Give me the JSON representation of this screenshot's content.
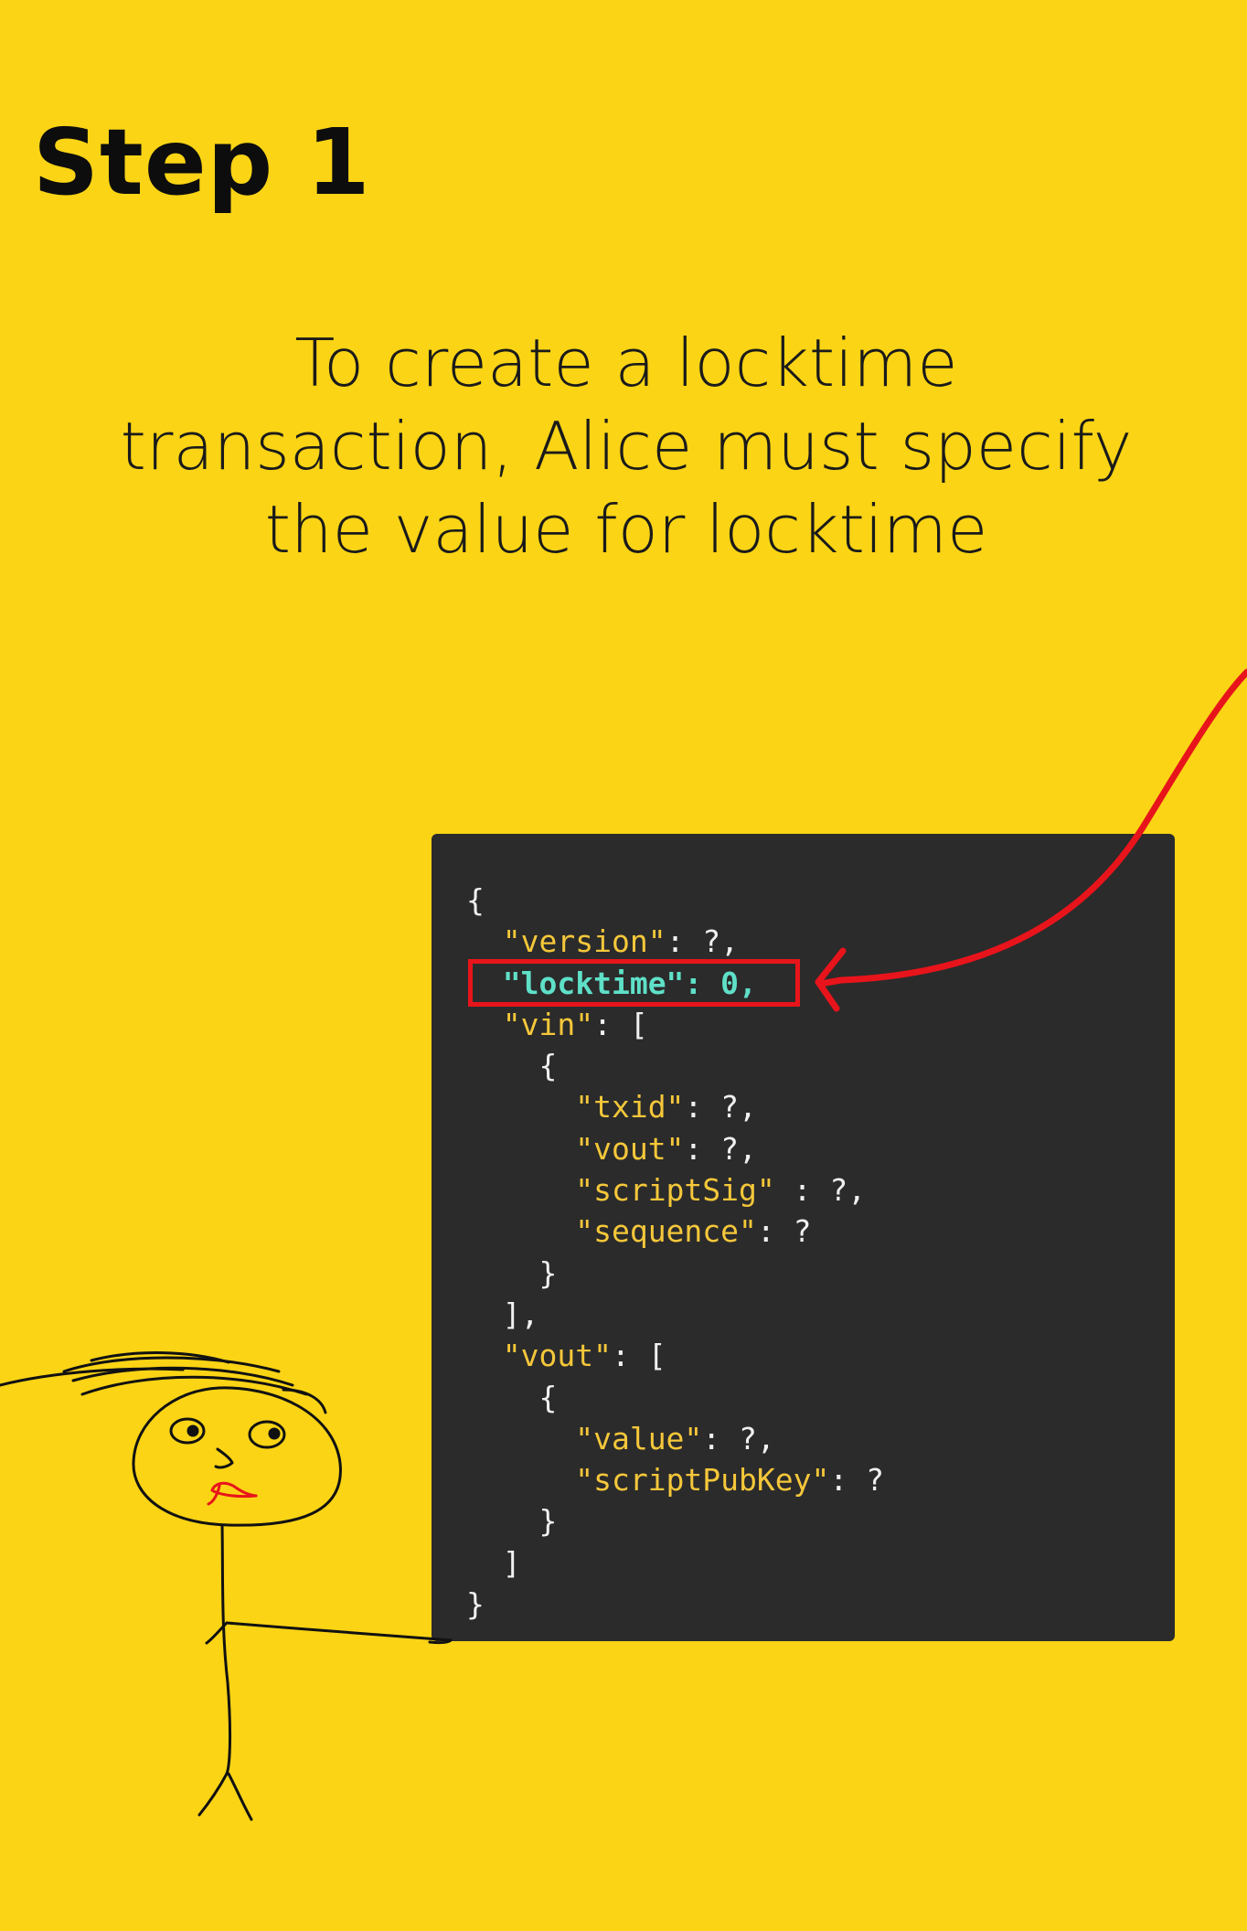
{
  "heading": "Step 1",
  "caption": {
    "line1": "To create a locktime",
    "line2": "transaction, Alice must specify",
    "line3": "the value for locktime"
  },
  "code": {
    "lines": [
      "{",
      "  \"version\": ?,",
      "  \"locktime\": 0,",
      "  \"vin\": [",
      "    {",
      "      \"txid\": ?,",
      "      \"vout\": ?,",
      "      \"scriptSig\" : ?,",
      "      \"sequence\": ?",
      "    }",
      "  ],",
      "  \"vout\": [",
      "    {",
      "      \"value\": ?,",
      "      \"scriptPubKey\": ?",
      "    }",
      "  ]",
      "}"
    ],
    "highlighted_line": 2
  },
  "colors": {
    "background": "#fad415",
    "code_background": "#2b2b2b",
    "key_color": "#f5c73a",
    "highlight_color": "#5fe0c8",
    "annotation_red": "#e8141b"
  },
  "icons": [
    "stick-figure",
    "red-arrow"
  ]
}
